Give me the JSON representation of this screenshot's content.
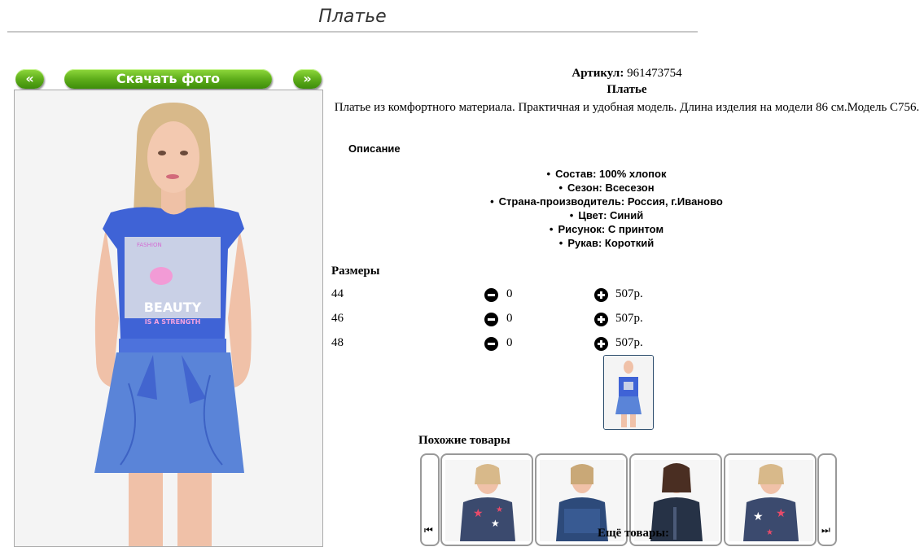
{
  "page": {
    "title": "Платье"
  },
  "gallery": {
    "prev_label": "«",
    "next_label": "»",
    "download_label": "Скачать фото",
    "main_print_text_1": "BEAUTY",
    "main_print_text_2": "IS A STRENGTH",
    "main_print_text_3": "FASHION"
  },
  "product": {
    "sku_label": "Артикул:",
    "sku_value": "961473754",
    "name": "Платье",
    "description": "Платье из комфортного материала. Практичная и удобная модель. Длина изделия на модели 86 см.Модель С756."
  },
  "details": {
    "heading": "Описание",
    "attributes": [
      "Состав: 100% хлопок",
      "Сезон: Всесезон",
      "Страна-производитель: Россия, г.Иваново",
      "Цвет: Синий",
      "Рисунок: С принтом",
      "Рукав: Короткий"
    ]
  },
  "sizes": {
    "heading": "Размеры",
    "rows": [
      {
        "size": "44",
        "qty": "0",
        "price": "507р."
      },
      {
        "size": "46",
        "qty": "0",
        "price": "507р."
      },
      {
        "size": "48",
        "qty": "0",
        "price": "507р."
      }
    ]
  },
  "similar": {
    "heading": "Похожие товары",
    "more_label": "Ещё товары:",
    "prev_glyph": "⏮",
    "next_glyph": "⏭"
  },
  "colors": {
    "button_green": "#5fae1b",
    "dress_blue": "#3f63d6",
    "denim_blue": "#5a84d8",
    "skin": "#f1c7ae",
    "hair": "#d8b98a"
  }
}
